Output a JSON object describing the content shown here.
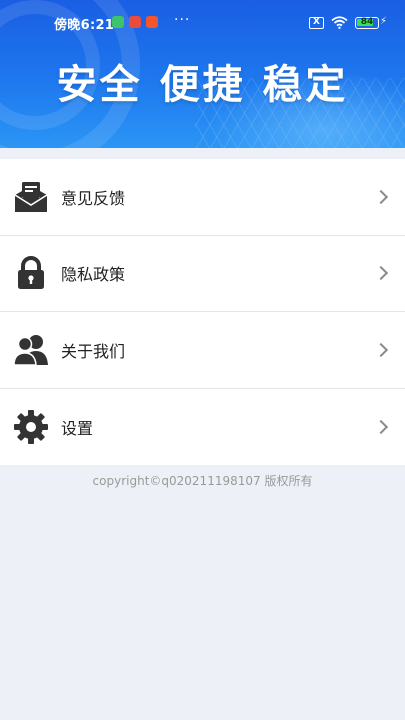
{
  "status_bar": {
    "time": "傍晚6:21",
    "more": "···",
    "battery": "84",
    "battery_level": 84,
    "sim_icon": "X"
  },
  "banner": {
    "slogan": "安全 便捷 稳定"
  },
  "menu": {
    "items": [
      {
        "label": "意见反馈",
        "icon": "feedback-mail-icon"
      },
      {
        "label": "隐私政策",
        "icon": "lock-icon"
      },
      {
        "label": "关于我们",
        "icon": "users-icon"
      },
      {
        "label": "设置",
        "icon": "gear-icon"
      }
    ]
  },
  "footer": {
    "copyright": "copyright©q020211198107 版权所有"
  },
  "colors": {
    "banner_top": "#1a5ee3",
    "banner_bottom": "#2b95f5",
    "page_bg": "#edf0f7",
    "icon": "#333333",
    "chevron": "#8a8a8a"
  }
}
